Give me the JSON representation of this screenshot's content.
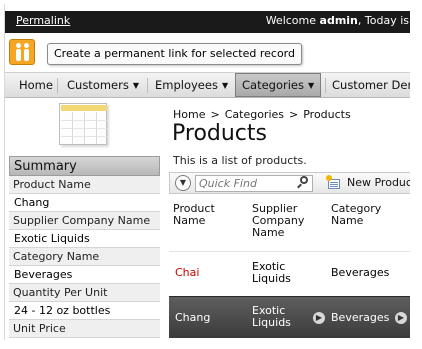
{
  "topbar": {
    "permalink": "Permalink",
    "welcome_prefix": "Welcome ",
    "user": "admin",
    "welcome_suffix": ", Today is"
  },
  "permalink_tooltip": "Create a permanent link for selected record",
  "menu": {
    "items": [
      {
        "label": "Home",
        "caret": ""
      },
      {
        "label": "Customers",
        "caret": "▼"
      },
      {
        "label": "Employees",
        "caret": "▼"
      },
      {
        "label": "Categories",
        "caret": "▼"
      },
      {
        "label": "Customer Dem",
        "caret": ""
      }
    ],
    "active": "Categories"
  },
  "summary": {
    "title": "Summary",
    "fields": [
      {
        "label": "Product Name",
        "value": "Chang"
      },
      {
        "label": "Supplier Company Name",
        "value": "Exotic Liquids"
      },
      {
        "label": "Category Name",
        "value": "Beverages"
      },
      {
        "label": "Quantity Per Unit",
        "value": "24 - 12 oz bottles"
      },
      {
        "label": "Unit Price",
        "value": ""
      }
    ]
  },
  "breadcrumb": [
    "Home",
    "Categories",
    "Products"
  ],
  "breadcrumb_sep": ">",
  "page_title": "Products",
  "page_description": "This is a list of products.",
  "toolbar": {
    "quick_find_placeholder": "Quick Find",
    "new_product": "New Product"
  },
  "grid": {
    "headers": [
      "Product\nName",
      "Supplier\nCompany\nName",
      "Category\nName"
    ],
    "rows": [
      {
        "product": "Chai",
        "supplier": "Exotic\nLiquids",
        "category": "Beverages",
        "selected": false
      },
      {
        "product": "Chang",
        "supplier": "Exotic\nLiquids",
        "category": "Beverages",
        "selected": true
      }
    ]
  },
  "colors": {
    "topbar": "#1a1a1a",
    "link_red": "#cc0000",
    "selected_row": "#4a4a4a",
    "permalink_icon": "#f5a623"
  }
}
